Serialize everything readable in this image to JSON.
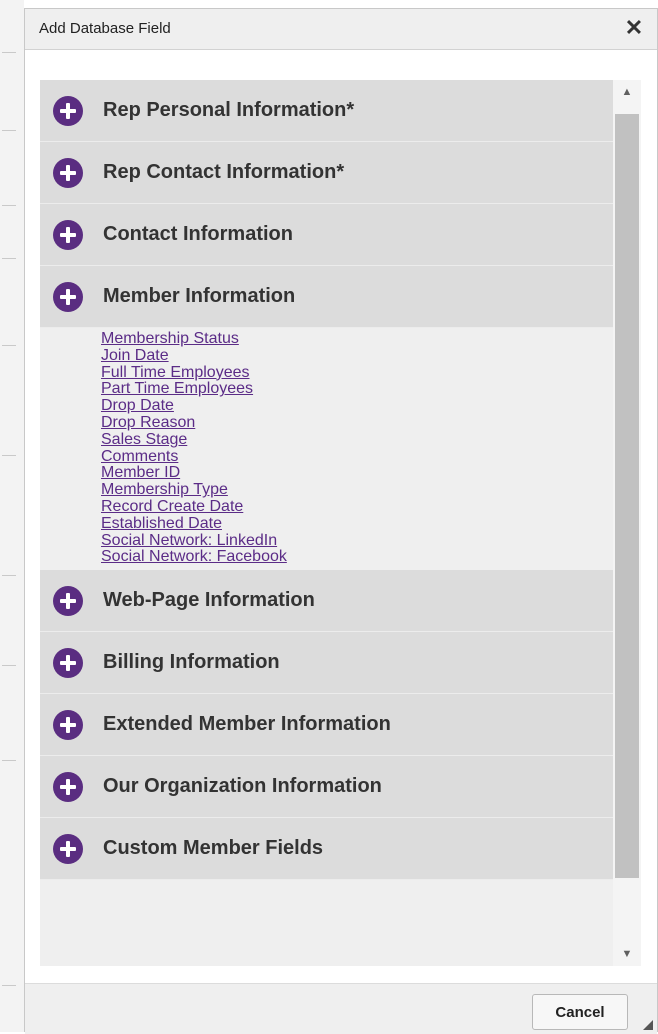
{
  "dialog": {
    "title": "Add Database Field",
    "close_glyph": "✕"
  },
  "categories_top": [
    {
      "label": "Rep Personal Information*",
      "icon": "plus-circle-icon"
    },
    {
      "label": "Rep Contact Information*",
      "icon": "plus-circle-icon"
    },
    {
      "label": "Contact Information",
      "icon": "plus-circle-icon"
    },
    {
      "label": "Member Information",
      "icon": "plus-circle-icon",
      "expanded": true
    }
  ],
  "member_fields": [
    "Membership Status",
    "Join Date",
    "Full Time Employees",
    "Part Time Employees",
    "Drop Date",
    "Drop Reason",
    "Sales Stage",
    "Comments",
    "Member ID",
    "Membership Type",
    "Record Create Date",
    "Established Date",
    "Social Network: LinkedIn",
    "Social Network: Facebook"
  ],
  "categories_bottom": [
    {
      "label": "Web-Page Information",
      "icon": "plus-circle-icon"
    },
    {
      "label": "Billing Information",
      "icon": "plus-circle-icon"
    },
    {
      "label": "Extended Member Information",
      "icon": "plus-circle-icon"
    },
    {
      "label": "Our Organization Information",
      "icon": "plus-circle-icon"
    },
    {
      "label": "Custom Member Fields",
      "icon": "plus-circle-icon"
    }
  ],
  "scrollbar": {
    "up_glyph": "▲",
    "down_glyph": "▼"
  },
  "footer": {
    "cancel_label": "Cancel"
  },
  "colors": {
    "accent_purple": "#5a2d81",
    "link_purple": "#5b2c87",
    "category_bg": "#dcdcdc"
  }
}
